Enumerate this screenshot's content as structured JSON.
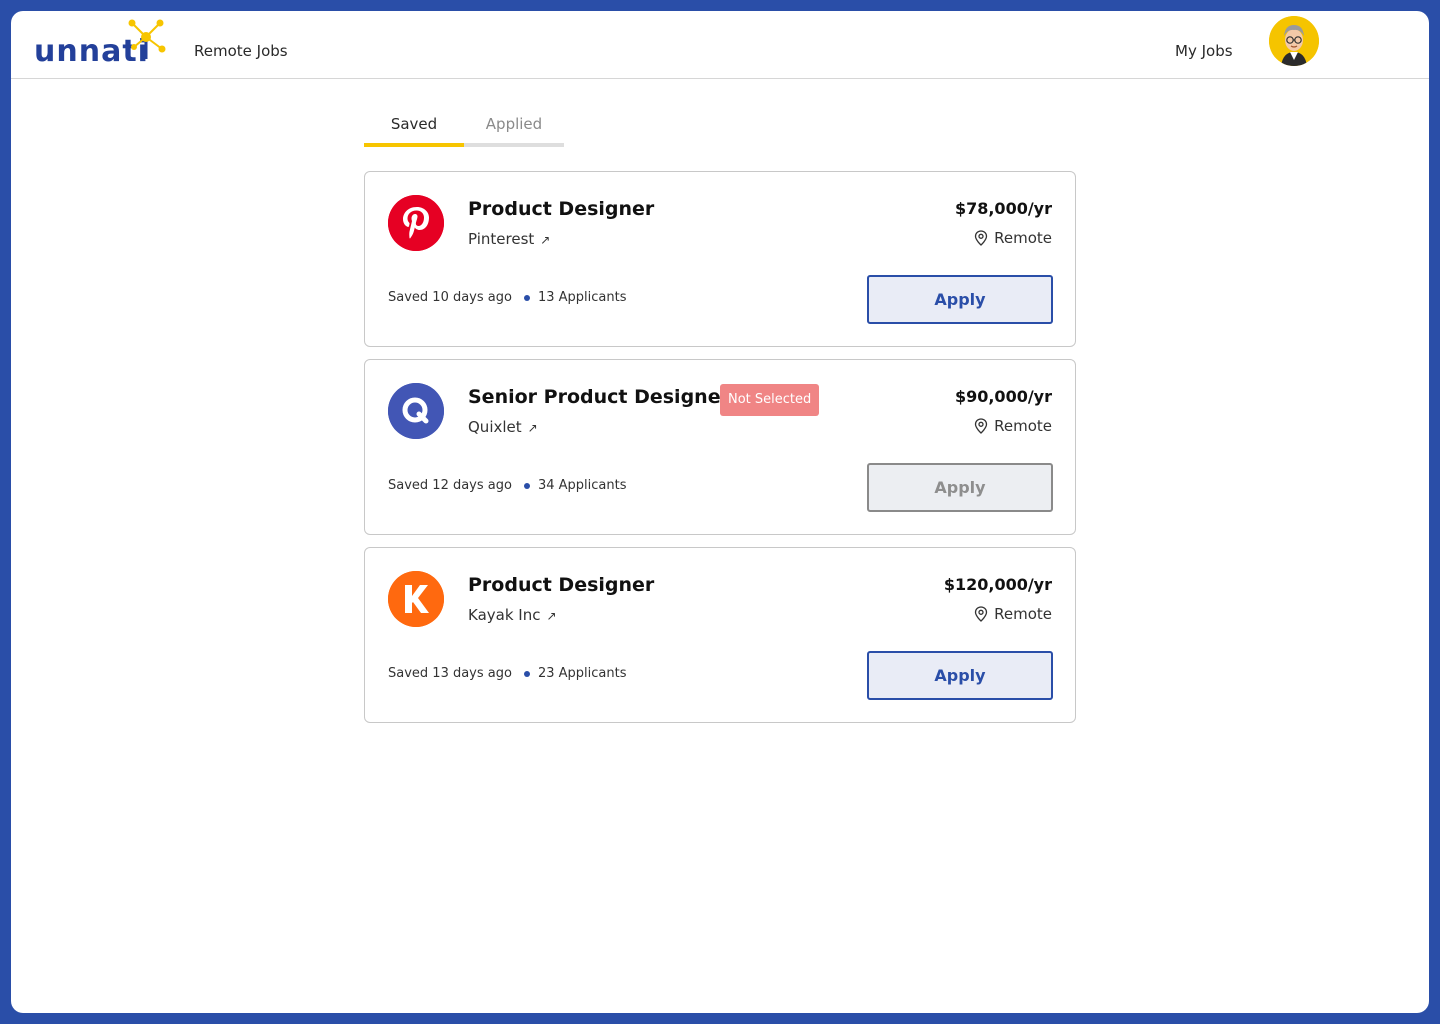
{
  "header": {
    "logo_text": "unnati",
    "nav_remote_jobs": "Remote Jobs",
    "nav_my_jobs": "My Jobs"
  },
  "tabs": [
    {
      "label": "Saved",
      "active": true
    },
    {
      "label": "Applied",
      "active": false
    }
  ],
  "jobs": [
    {
      "title": "Product Designer",
      "company": "Pinterest",
      "logo_letter": "P",
      "logo_color": "#e60023",
      "salary": "$78,000/yr",
      "location": "Remote",
      "saved": "Saved 10 days ago",
      "applicants": "13 Applicants",
      "status": "",
      "apply_label": "Apply",
      "apply_enabled": true
    },
    {
      "title": "Senior Product Designer",
      "company": "Quixlet",
      "logo_letter": "Q",
      "logo_color": "#4256b5",
      "salary": "$90,000/yr",
      "location": "Remote",
      "saved": "Saved 12 days ago",
      "applicants": "34 Applicants",
      "status": "Not Selected",
      "apply_label": "Apply",
      "apply_enabled": false
    },
    {
      "title": "Product Designer",
      "company": "Kayak Inc",
      "logo_letter": "K",
      "logo_color": "#ff690f",
      "salary": "$120,000/yr",
      "location": "Remote",
      "saved": "Saved 13 days ago",
      "applicants": "23 Applicants",
      "status": "",
      "apply_label": "Apply",
      "apply_enabled": true
    }
  ],
  "colors": {
    "frame": "#2a4ea8",
    "brand_blue": "#23409a",
    "accent_yellow": "#f7c500",
    "status_red": "#f08585"
  }
}
